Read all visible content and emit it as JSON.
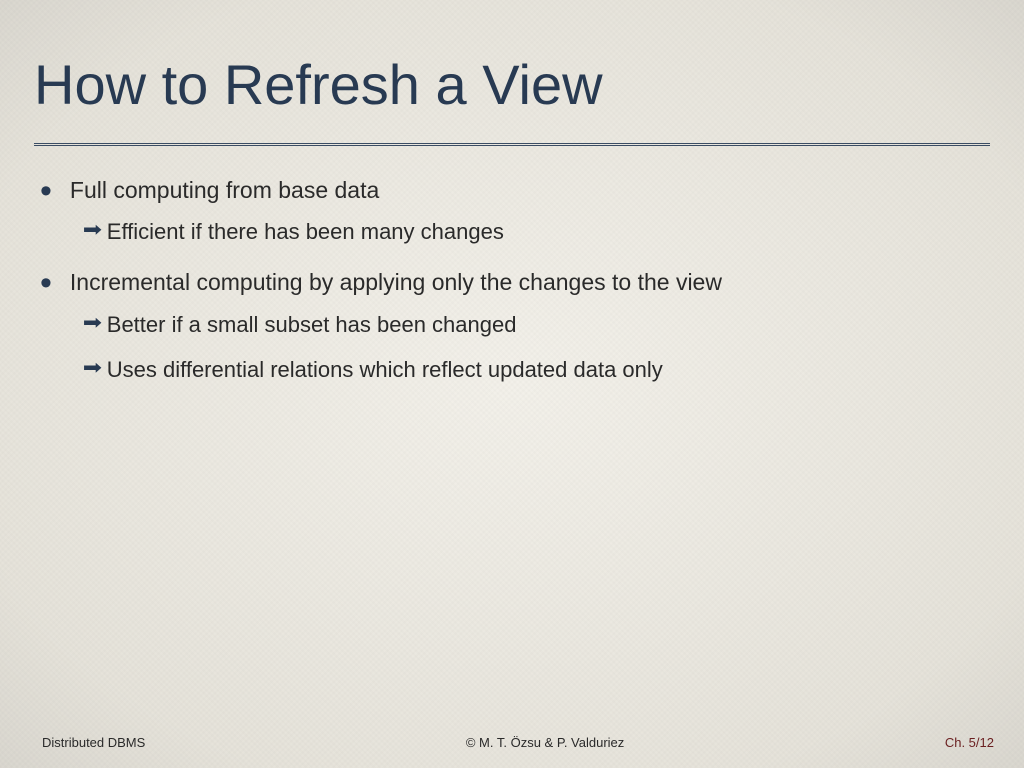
{
  "title": "How to Refresh a View",
  "bullets": [
    {
      "text": "Full computing from base data",
      "subs": [
        "Efficient if there has been many changes"
      ]
    },
    {
      "text": "Incremental computing by applying only the changes to the view",
      "subs": [
        "Better if a small subset has been changed",
        "Uses differential relations which reflect updated data only"
      ]
    }
  ],
  "footer": {
    "left": "Distributed DBMS",
    "center": "© M. T. Özsu & P. Valduriez",
    "right": "Ch. 5/12"
  },
  "glyphs": {
    "bullet": "•",
    "arrow": "➡"
  }
}
